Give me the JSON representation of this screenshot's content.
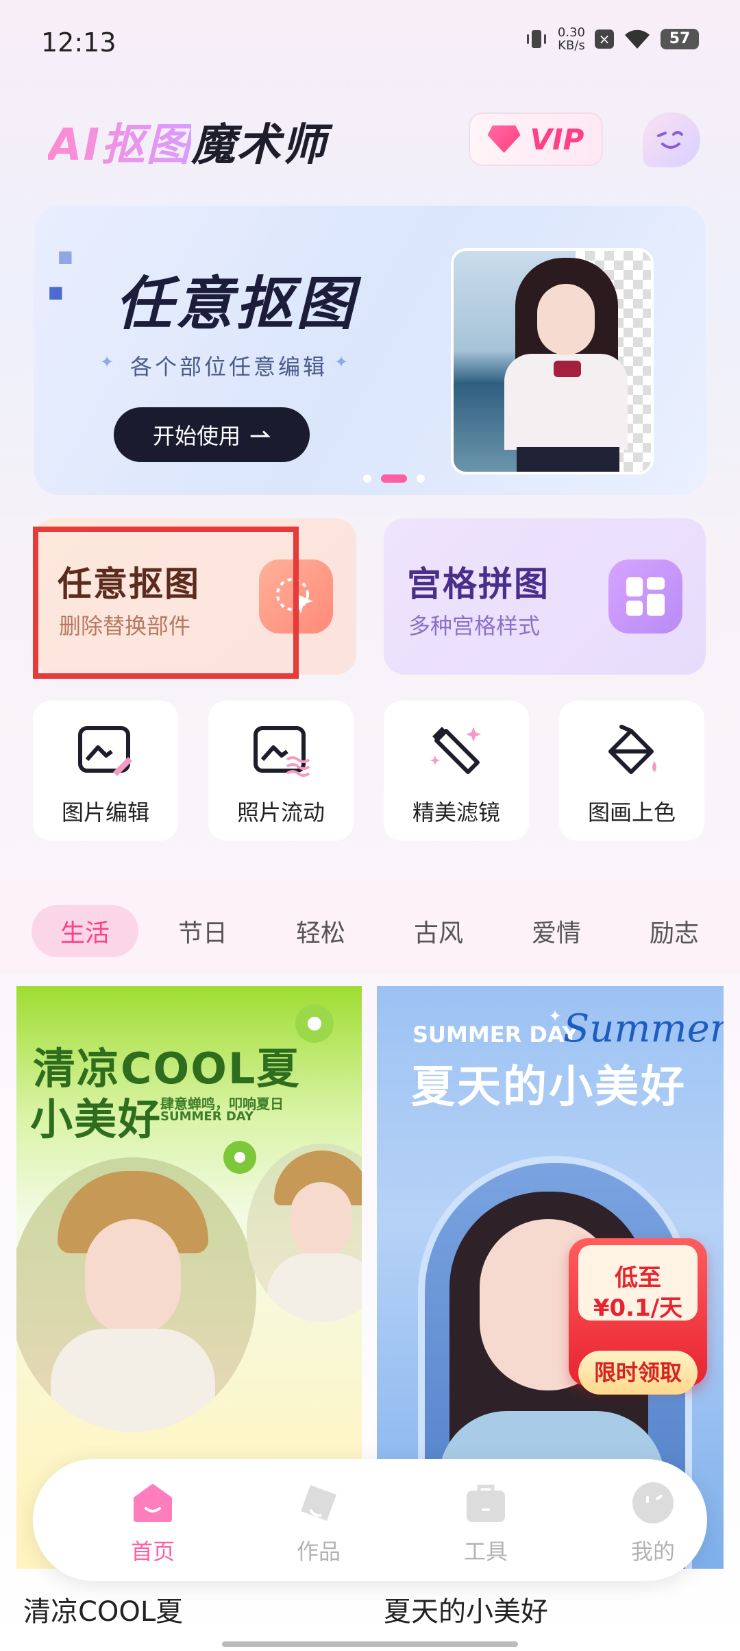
{
  "status_bar": {
    "time": "12:13",
    "net_speed_value": "0.30",
    "net_speed_unit": "KB/s",
    "battery": "57"
  },
  "header": {
    "title_ai": "AI抠图",
    "title_rest": "魔术师",
    "vip_label": "VIP"
  },
  "banner": {
    "title": "任意抠图",
    "subtitle": "各个部位任意编辑",
    "button_label": "开始使用",
    "page_count": 3,
    "active_page": 2
  },
  "feature_cards": [
    {
      "title": "任意抠图",
      "subtitle": "删除替换部件"
    },
    {
      "title": "宫格拼图",
      "subtitle": "多种宫格样式"
    }
  ],
  "tools": [
    {
      "label": "图片编辑",
      "icon": "image-edit-icon"
    },
    {
      "label": "照片流动",
      "icon": "photo-flow-icon"
    },
    {
      "label": "精美滤镜",
      "icon": "filter-wand-icon"
    },
    {
      "label": "图画上色",
      "icon": "paint-bucket-icon"
    }
  ],
  "categories": [
    "生活",
    "节日",
    "轻松",
    "古风",
    "爱情",
    "励志"
  ],
  "active_category": "生活",
  "templates": [
    {
      "caption": "清凉COOL夏",
      "headline_1": "清凉COOL夏",
      "headline_2": "小美好",
      "tagline_1": "肆意蝉鸣，叩响夏日",
      "tagline_2": "SUMMER DAY"
    },
    {
      "caption": "夏天的小美好",
      "tagline_en": "SUMMER DAY",
      "script": "Summer",
      "headline": "夏天的小美好"
    }
  ],
  "promo": {
    "line1": "低至",
    "line2": "¥0.1/天",
    "button_label": "限时领取"
  },
  "bottom_nav": [
    {
      "label": "首页",
      "icon": "home-icon",
      "active": true
    },
    {
      "label": "作品",
      "icon": "works-icon",
      "active": false
    },
    {
      "label": "工具",
      "icon": "toolbox-icon",
      "active": false
    },
    {
      "label": "我的",
      "icon": "profile-icon",
      "active": false
    }
  ],
  "colors": {
    "accent_pink": "#ff5fa2",
    "highlight_red": "#e53b3b",
    "dark": "#1b1b30"
  }
}
